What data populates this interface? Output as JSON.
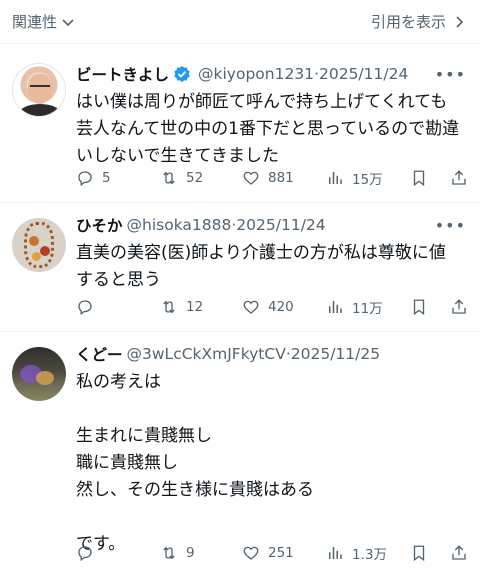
{
  "header": {
    "sort_label": "関連性",
    "quotes_label": "引用を表示"
  },
  "colors": {
    "text": "#0f1419",
    "muted": "#536471",
    "verified": "#1d9bf0",
    "divider": "#eff3f4"
  },
  "replies": [
    {
      "name": "ビートきよし",
      "verified": true,
      "handle": "@kiyopon1231",
      "separator": "·",
      "date": "2025/11/24",
      "text": "はい僕は周りが師匠て呼んで持ち上げてくれても\n芸人なんて世の中の1番下だと思っているので勘違\nいしないで生きてきました",
      "replies": "5",
      "reposts": "52",
      "likes": "881",
      "views": "15万"
    },
    {
      "name": "ひそか",
      "verified": false,
      "handle": "@hisoka1888",
      "separator": "·",
      "date": "2025/11/24",
      "text": "直美の美容(医)師より介護士の方が私は尊敬に値\nすると思う",
      "replies": "",
      "reposts": "12",
      "likes": "420",
      "views": "11万"
    },
    {
      "name": "くどー",
      "verified": false,
      "handle": "@3wLcCkXmJFkytCV",
      "separator": "·",
      "date": "2025/11/25",
      "text": "私の考えは\n\n生まれに貴賤無し\n職に貴賤無し\n然し、その生き様に貴賤はある\n\nです。",
      "replies": "",
      "reposts": "9",
      "likes": "251",
      "views": "1.3万"
    }
  ]
}
